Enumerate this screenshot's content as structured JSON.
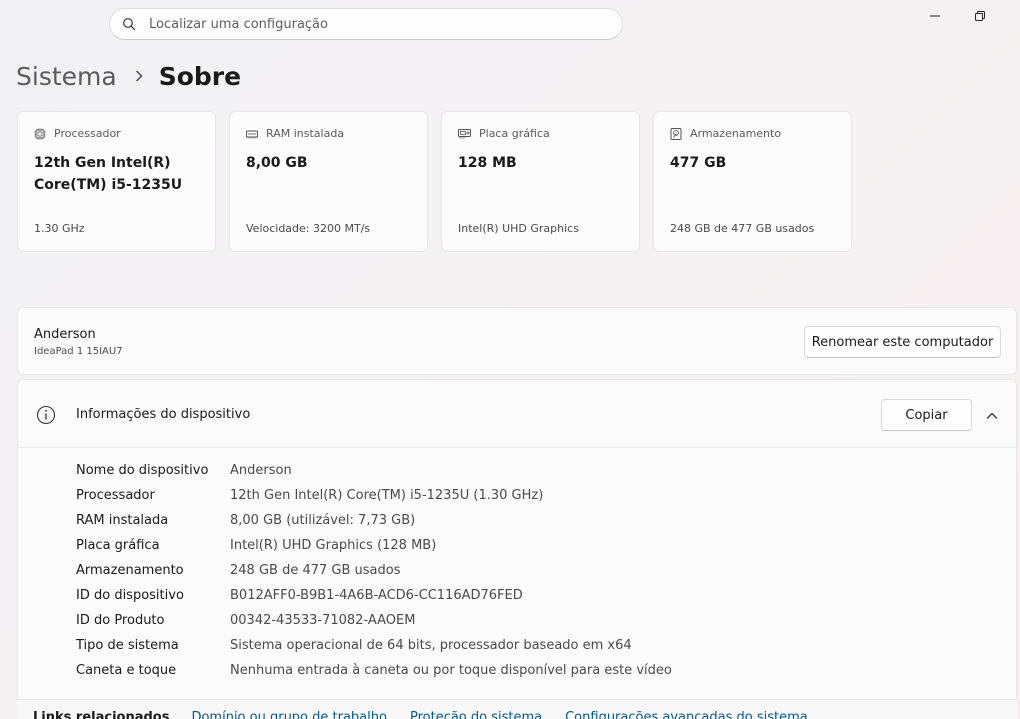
{
  "search": {
    "placeholder": "Localizar uma configuração"
  },
  "breadcrumb": {
    "parent": "Sistema",
    "current": "Sobre"
  },
  "cards": [
    {
      "label": "Processador",
      "value": "12th Gen Intel(R) Core(TM) i5-1235U",
      "sub": "1.30 GHz",
      "icon": "processor-icon"
    },
    {
      "label": "RAM instalada",
      "value": "8,00 GB",
      "sub": "Velocidade: 3200 MT/s",
      "icon": "ram-icon"
    },
    {
      "label": "Placa gráfica",
      "value": "128 MB",
      "sub": "Intel(R) UHD Graphics",
      "icon": "gpu-icon"
    },
    {
      "label": "Armazenamento",
      "value": "477 GB",
      "sub": "248 GB de 477 GB usados",
      "icon": "storage-icon"
    }
  ],
  "device": {
    "name": "Anderson",
    "model": "IdeaPad 1 15IAU7",
    "rename_label": "Renomear este computador"
  },
  "info": {
    "title": "Informações do dispositivo",
    "copy_label": "Copiar",
    "rows": [
      {
        "key": "Nome do dispositivo",
        "value": "Anderson"
      },
      {
        "key": "Processador",
        "value": "12th Gen Intel(R) Core(TM) i5-1235U (1.30 GHz)"
      },
      {
        "key": "RAM instalada",
        "value": "8,00 GB (utilizável: 7,73 GB)"
      },
      {
        "key": "Placa gráfica",
        "value": "Intel(R) UHD Graphics (128 MB)"
      },
      {
        "key": "Armazenamento",
        "value": "248 GB de 477 GB usados"
      },
      {
        "key": "ID do dispositivo",
        "value": "B012AFF0-B9B1-4A6B-ACD6-CC116AD76FED"
      },
      {
        "key": "ID do Produto",
        "value": "00342-43533-71082-AAOEM"
      },
      {
        "key": "Tipo de sistema",
        "value": "Sistema operacional de 64 bits, processador baseado em x64"
      },
      {
        "key": "Caneta e toque",
        "value": "Nenhuma entrada à caneta ou por toque disponível para este vídeo"
      }
    ]
  },
  "related": {
    "label": "Links relacionados",
    "links": [
      "Domínio ou grupo de trabalho",
      "Proteção do sistema",
      "Configurações avançadas do sistema"
    ]
  },
  "colors": {
    "link": "#005a9e",
    "text": "#1a1a1a",
    "secondary": "#4a4a4a"
  }
}
